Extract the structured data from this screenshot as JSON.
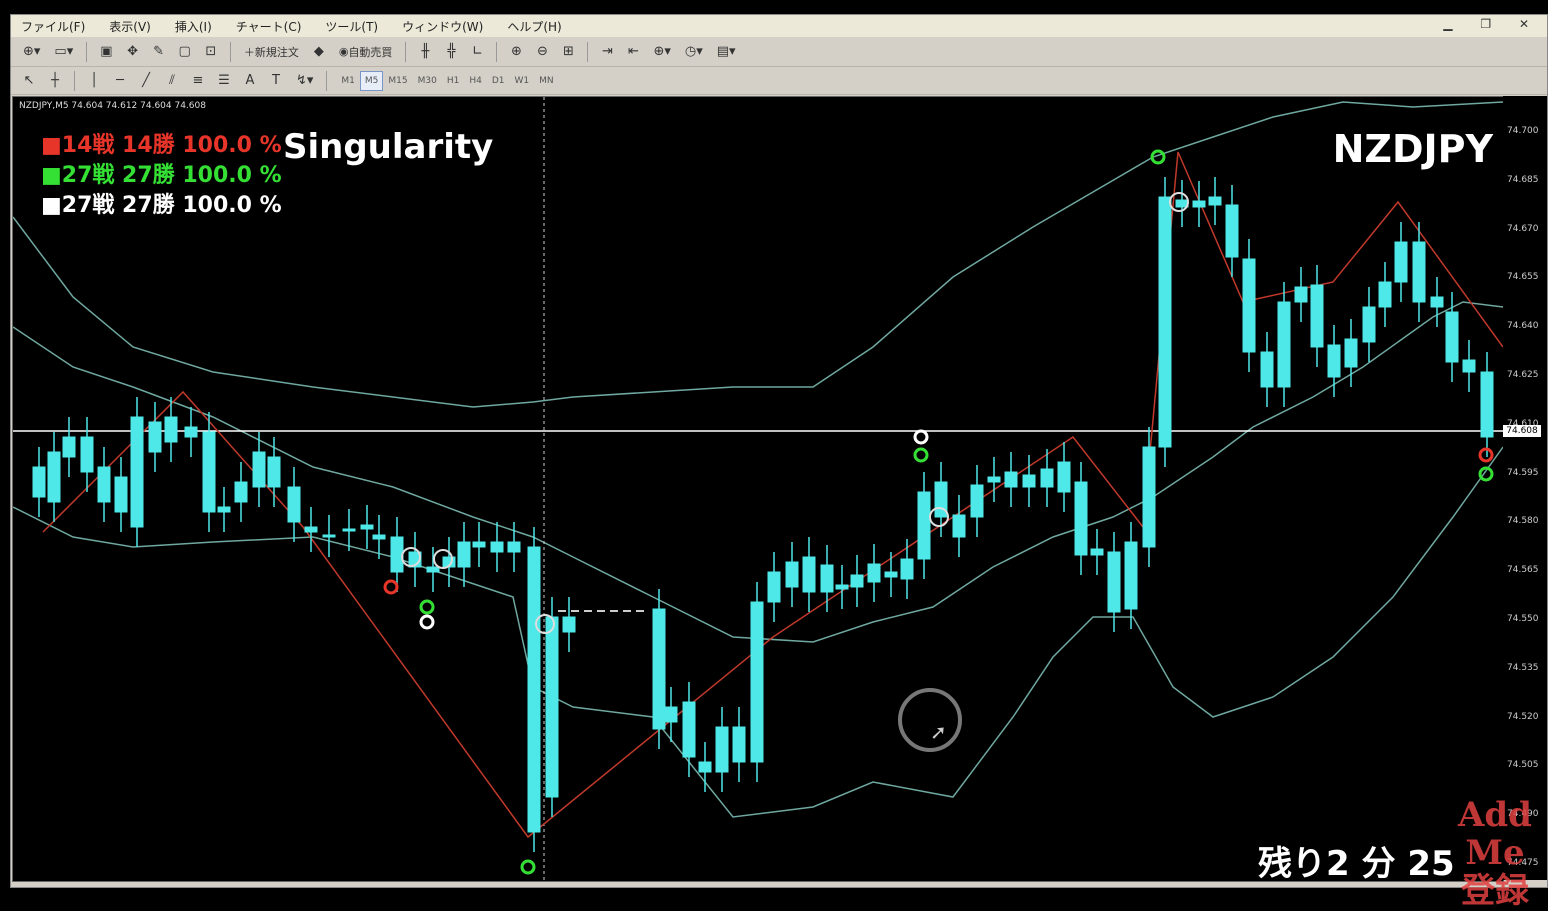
{
  "menu": {
    "items": [
      "ファイル(F)",
      "表示(V)",
      "挿入(I)",
      "チャート(C)",
      "ツール(T)",
      "ウィンドウ(W)",
      "ヘルプ(H)"
    ]
  },
  "toolbar1": {
    "new_order": "新規注文",
    "auto_trade": "自動売買"
  },
  "timeframes": [
    "M1",
    "M5",
    "M15",
    "M30",
    "H1",
    "H4",
    "D1",
    "W1",
    "MN"
  ],
  "active_timeframe": "M5",
  "chart_header": "NZDJPY,M5 74.604 74.612 74.604 74.608",
  "stats": {
    "red": "■14戦 14勝 100.0 %",
    "green": "■27戦 27勝 100.0 %",
    "white": "■27戦 27勝 100.0 %"
  },
  "ea_name": "Singularity",
  "symbol": "NZDJPY",
  "countdown": "残り2 分 25",
  "watermark": {
    "line1": "Add Me",
    "line2": "登録"
  },
  "price_axis": [
    "74.700",
    "74.685",
    "74.670",
    "74.655",
    "74.640",
    "74.625",
    "74.610",
    "74.595",
    "74.580",
    "74.565",
    "74.550",
    "74.535",
    "74.520",
    "74.505",
    "74.490",
    "74.475"
  ],
  "current_price": "74.608",
  "colors": {
    "bull_candle": "#4ee8e8",
    "bear_candle": "#000000",
    "bands": "#6fa8a0",
    "zigzag": "#c0392b",
    "stat_red": "#e8352a",
    "stat_green": "#35e035"
  }
}
